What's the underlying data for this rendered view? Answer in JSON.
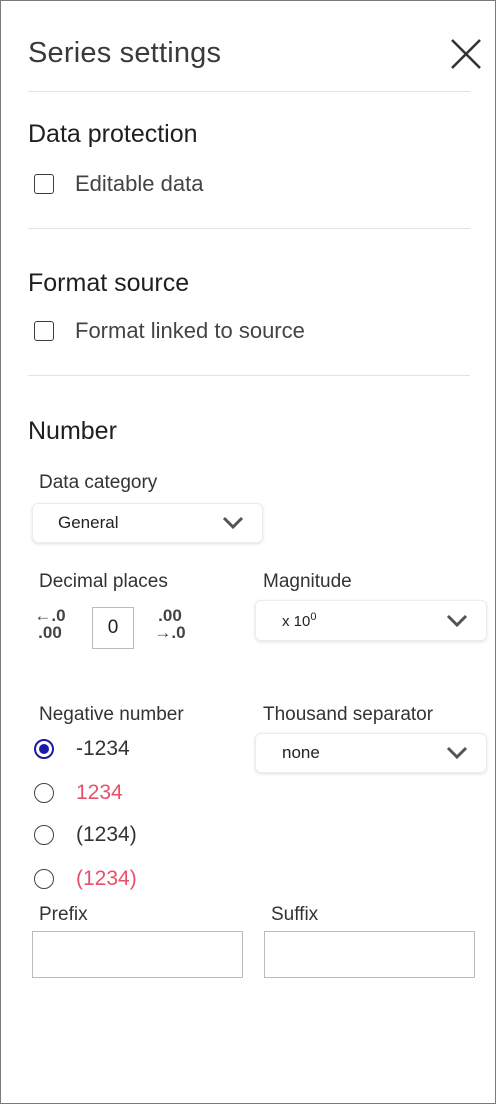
{
  "header": {
    "title": "Series settings",
    "close_icon": "close-icon"
  },
  "data_protection": {
    "title": "Data protection",
    "checkbox_label": "Editable data",
    "checked": false
  },
  "format_source": {
    "title": "Format source",
    "checkbox_label": "Format linked to source",
    "checked": false
  },
  "number": {
    "title": "Number",
    "data_category": {
      "label": "Data category",
      "value": "General"
    },
    "decimal_places": {
      "label": "Decimal places",
      "value": "0",
      "decrease_icon": "decrease-decimal-icon",
      "increase_icon": "increase-decimal-icon"
    },
    "magnitude": {
      "label": "Magnitude",
      "value_base": "x 10",
      "value_exp": "0"
    },
    "negative_number": {
      "label": "Negative number",
      "options": [
        {
          "label": "-1234",
          "selected": true,
          "color": "#333333"
        },
        {
          "label": "1234",
          "selected": false,
          "color": "#e8506a"
        },
        {
          "label": "(1234)",
          "selected": false,
          "color": "#333333"
        },
        {
          "label": "(1234)",
          "selected": false,
          "color": "#e8506a"
        }
      ]
    },
    "thousand_separator": {
      "label": "Thousand separator",
      "value": "none"
    },
    "prefix": {
      "label": "Prefix",
      "value": ""
    },
    "suffix": {
      "label": "Suffix",
      "value": ""
    }
  },
  "colors": {
    "accent": "#1a1aa8",
    "negative_red": "#e8506a"
  }
}
